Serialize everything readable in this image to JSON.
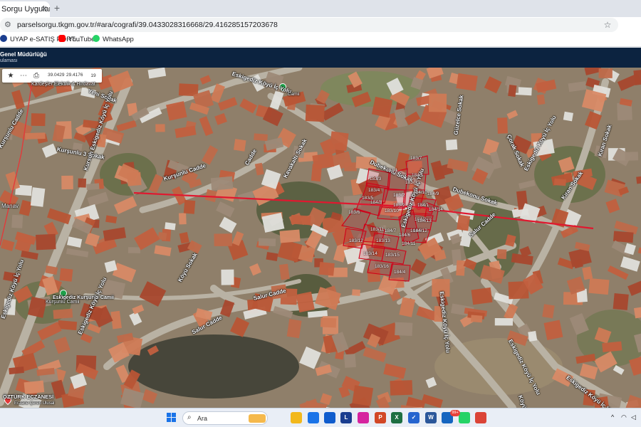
{
  "browser": {
    "tab_title": "Sorgu Uygulamas",
    "url": "parselsorgu.tkgm.gov.tr/#ara/cografi/39.0433028316668/29.416285157203678",
    "bookmarks": [
      {
        "label": "UYAP e-SATIŞ PORT...",
        "icon": "uyap-icon",
        "color": "#1a3d8f"
      },
      {
        "label": "YouTube",
        "icon": "youtube-icon",
        "color": "#ff0000"
      },
      {
        "label": "WhatsApp",
        "icon": "whatsapp-icon",
        "color": "#25d366"
      }
    ]
  },
  "site": {
    "org_line1": "Genel Müdürlüğü",
    "org_line2": "ulaması"
  },
  "map": {
    "toolbar": {
      "lat": "39.0429",
      "lon": "29.4176",
      "zoom": "19"
    },
    "street_labels": [
      "Eskigediz Köyü İç Yolu",
      "Yeni Sokak",
      "Kardeşler Elektrik & Hırdavat",
      "Kurşunlu 3 Sokak",
      "Kurşunlu Cadde",
      "Kurşunlu Cadde",
      "Kursun Eskigediz Köyü İç Yolu",
      "Manav",
      "Kavakaltı Sokak",
      "Cadde",
      "Dubekonu Sokak",
      "Dubekonu Sokak",
      "Güzelce Sokak",
      "Çorak Sokak",
      "Eskigediz Köyü İç Yolu",
      "Kıran Sokak",
      "Salur Cadde",
      "Salur Cadde",
      "Salur Cadde",
      "Köyü Sokak",
      "Eskigediz Köyü İç Yolu",
      "Eskigediz Köyü İç Yolu",
      "Eskigediz Köyü İç Yolu",
      "Eskigediz Köyü İç Yolu",
      "Eskigediz Kurşunlu Camii",
      "Eskigediz Köyü İç Yolu",
      "Eskigediz Köyü İç Yolu",
      "Kurşunlu Camii",
      "ÖZTÜRK ECZANESİ",
      "Eczane Çeren Ulusal",
      "Camii",
      "Köyü İç Yolu",
      "Kıran Sokak"
    ],
    "parcels": [
      "183/3",
      "183/1",
      "183/4",
      "183/5",
      "183/6",
      "183/7",
      "183/2",
      "183/8",
      "183/9",
      "183/10",
      "183/11",
      "183/12",
      "183/13",
      "183/14",
      "183/15",
      "183/16",
      "184/1",
      "184/2",
      "184/3",
      "184/4",
      "184/5",
      "184/6",
      "184/7",
      "184/8",
      "184/9",
      "184/10",
      "184/11",
      "184/12",
      "184/13",
      "184/14"
    ]
  },
  "taskbar": {
    "search_placeholder": "Ara",
    "badge": "99+",
    "apps": [
      {
        "name": "file-explorer-icon",
        "color": "#f2b81c",
        "glyph": ""
      },
      {
        "name": "store-icon",
        "color": "#1a73e8",
        "glyph": ""
      },
      {
        "name": "mail-icon",
        "color": "#0f5ccd",
        "glyph": ""
      },
      {
        "name": "lexicon-icon",
        "color": "#1a3d8f",
        "glyph": "L"
      },
      {
        "name": "instagram-icon",
        "color": "#d6249f",
        "glyph": ""
      },
      {
        "name": "powerpoint-icon",
        "color": "#d24726",
        "glyph": "P"
      },
      {
        "name": "excel-icon",
        "color": "#1d6f42",
        "glyph": "X"
      },
      {
        "name": "todo-icon",
        "color": "#2564cf",
        "glyph": "✓"
      },
      {
        "name": "word-icon",
        "color": "#2b579a",
        "glyph": "W"
      },
      {
        "name": "vpn-icon",
        "color": "#1565c0",
        "glyph": ""
      },
      {
        "name": "whatsapp-icon",
        "color": "#25d366",
        "glyph": ""
      },
      {
        "name": "chrome-icon",
        "color": "#db4437",
        "glyph": ""
      }
    ]
  }
}
